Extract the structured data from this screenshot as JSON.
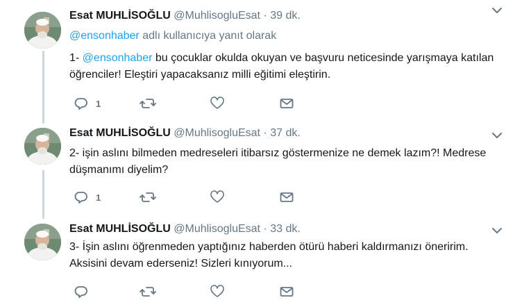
{
  "tweets": [
    {
      "name": "Esat MUHLİSOĞLU",
      "handle": "@MuhlisogluEsat",
      "dot": "·",
      "time": "39 dk.",
      "reply_mention": "@ensonhaber",
      "reply_suffix": " adlı kullanıcıya yanıt olarak",
      "text_prefix": "1- ",
      "text_mention": "@ensonhaber",
      "text_rest": " bu çocuklar okulda okuyan ve başvuru neticesinde yarışmaya katılan öğrenciler! Eleştiri yapacaksanız milli eğitimi eleştirin.",
      "reply_count": "1"
    },
    {
      "name": "Esat MUHLİSOĞLU",
      "handle": "@MuhlisogluEsat",
      "dot": "·",
      "time": "37 dk.",
      "text": "2- işin aslını bilmeden medreseleri itibarsız göstermenize ne demek lazım?! Medrese düşmanımı diyelim?",
      "reply_count": "1"
    },
    {
      "name": "Esat MUHLİSOĞLU",
      "handle": "@MuhlisogluEsat",
      "dot": "·",
      "time": "33 dk.",
      "text": "3- İşin aslını öğrenmeden yaptığınız haberden ötürü haberi kaldırmanızı öneririm. Aksisini devam ederseniz! Sizleri kınıyorum...",
      "reply_count": ""
    }
  ],
  "colors": {
    "link": "#1da1f2",
    "muted": "#657786",
    "thread_line": "#ccd6dd"
  },
  "icons": [
    "reply-icon",
    "retweet-icon",
    "like-icon",
    "direct-message-icon",
    "chevron-down-icon"
  ]
}
